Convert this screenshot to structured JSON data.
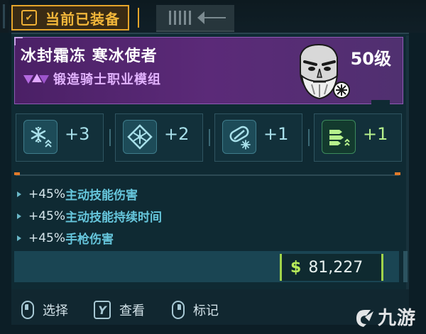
{
  "header": {
    "active_tab_label": "当前已装备",
    "active_tab_icon": "checkmark-box-icon",
    "inactive_tab_icon": "comb-blade-icon"
  },
  "module": {
    "title": "冰封霜冻 寒冰使者",
    "subtitle": "锻造骑士职业模组",
    "level": "50级",
    "rarity_icon": "purple-rarity-chevrons-icon",
    "portrait_icon": "bearded-skull-portrait-icon",
    "rarity_color": "#8f5bb5"
  },
  "stats": [
    {
      "icon": "cryo-snowflake-icon",
      "value": "+3",
      "color": "#a8e0ea"
    },
    {
      "icon": "cryo-target-icon",
      "value": "+2",
      "color": "#a8e0ea"
    },
    {
      "icon": "grenade-cryo-icon",
      "value": "+1",
      "color": "#a8e0ea"
    },
    {
      "icon": "ammo-rounds-icon",
      "value": "+1",
      "color": "#b6f08c"
    }
  ],
  "effects": [
    {
      "amount": "+45%",
      "name": "主动技能伤害"
    },
    {
      "amount": "+45%",
      "name": "主动技能持续时间"
    },
    {
      "amount": "+45%",
      "name": "手枪伤害"
    }
  ],
  "price": {
    "currency_symbol": "$",
    "amount": "81,227"
  },
  "footer": {
    "hints": [
      {
        "key": "left-mouse-icon",
        "label": "选择"
      },
      {
        "key": "Y",
        "label": "查看"
      },
      {
        "key": "right-mouse-icon",
        "label": "标记"
      }
    ]
  },
  "watermark": {
    "text": "九游"
  },
  "colors": {
    "accent_orange": "#e6a52a",
    "effect_text": "#66c6dc",
    "price_green": "#a0d44a"
  }
}
